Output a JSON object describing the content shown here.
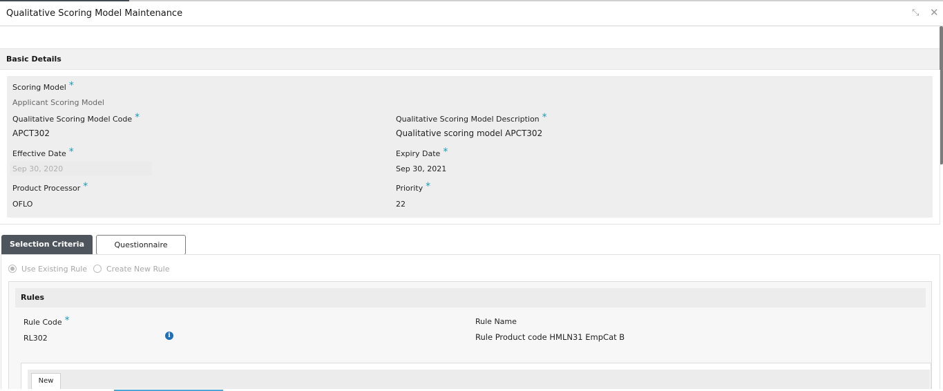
{
  "window": {
    "title": "Qualitative Scoring Model Maintenance",
    "minimize_icon": "collapse-arrows-icon",
    "close_icon": "close-icon",
    "minimize_glyph": "⤡",
    "close_glyph": "✕"
  },
  "basic_details": {
    "header": "Basic Details",
    "required_mark": "*",
    "fields": {
      "scoring_model": {
        "label": "Scoring Model",
        "value": "Applicant Scoring Model"
      },
      "model_code": {
        "label": "Qualitative Scoring Model Code",
        "value": "APCT302"
      },
      "model_description": {
        "label": "Qualitative Scoring Model Description",
        "value": "Qualitative scoring model APCT302"
      },
      "effective_date": {
        "label": "Effective Date",
        "value": "Sep 30, 2020"
      },
      "expiry_date": {
        "label": "Expiry Date",
        "value": "Sep 30, 2021"
      },
      "product_processor": {
        "label": "Product Processor",
        "value": "OFLO"
      },
      "priority": {
        "label": "Priority",
        "value": "22"
      }
    }
  },
  "tabs": [
    {
      "label": "Selection Criteria",
      "active": true
    },
    {
      "label": "Questionnaire",
      "active": false
    }
  ],
  "rule_options": [
    {
      "label": "Use Existing Rule",
      "selected": true
    },
    {
      "label": "Create New Rule",
      "selected": false
    }
  ],
  "rules": {
    "header": "Rules",
    "rule_code": {
      "label": "Rule Code",
      "value": "RL302"
    },
    "rule_name": {
      "label": "Rule Name",
      "value": "Rule Product code HMLN31 EmpCat B"
    },
    "info_icon": "info-icon",
    "info_glyph": "i",
    "new_button": "New"
  },
  "colors": {
    "accent_required": "#1a9bb5",
    "tab_active_bg": "#4e555d",
    "info_icon": "#1f6fb5"
  }
}
